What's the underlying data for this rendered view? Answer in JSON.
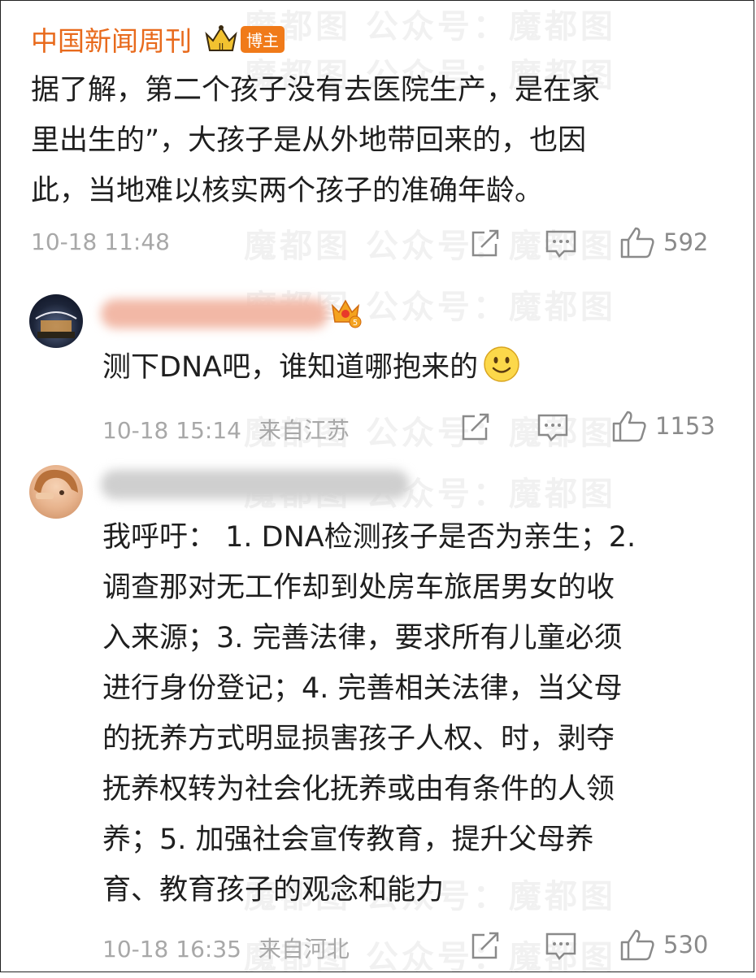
{
  "watermark": {
    "text": "魔都图 公众号：魔都图"
  },
  "post": {
    "author": "中国新闻周刊",
    "author_tag": "博主",
    "lines": [
      "据了解，第二个孩子没有去医院生产，是在家",
      "里出生的”，大孩子是从外地带回来的，也因",
      "此，当地难以核实两个孩子的准确年龄。"
    ],
    "time": "10-18 11:48",
    "likes": "592"
  },
  "comment1": {
    "text": "测下DNA吧，谁知道哪抱来的",
    "time": "10-18 15:14",
    "location": "来自江苏",
    "likes": "1153"
  },
  "comment2": {
    "lines": [
      "我呼吁： 1. DNA检测孩子是否为亲生；2.",
      "调查那对无工作却到处房车旅居男女的收",
      "入来源；3. 完善法律，要求所有儿童必须",
      "进行身份登记；4. 完善相关法律，当父母",
      "的抚养方式明显损害孩子人权、时，剥夺",
      "抚养权转为社会化抚养或由有条件的人领",
      "养；5. 加强社会宣传教育，提升父母养",
      "育、教育孩子的观念和能力"
    ],
    "time": "10-18 16:35",
    "location": "来自河北",
    "likes": "530"
  },
  "icons": [
    "crown-badge-icon",
    "share-icon",
    "comment-icon",
    "like-icon",
    "vip-crown-icon",
    "smile-emoji-icon"
  ],
  "colors": {
    "author": "#e86a1c",
    "tag_bg": "#f07a19",
    "meta": "#a8a8a8",
    "text": "#1f1f1f"
  }
}
